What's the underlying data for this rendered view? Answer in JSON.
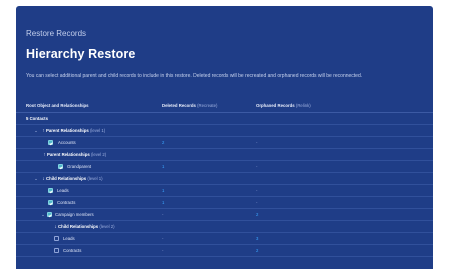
{
  "header": {
    "supertitle": "Restore Records",
    "title": "Hierarchy Restore",
    "description": "You can select additional parent and child records to include in this restore. Deleted records will be recreated and orphaned records will be reconnected."
  },
  "table": {
    "columns": {
      "object_label": "Root Object and Relationships",
      "deleted_label": "Deleted Records",
      "deleted_action": "(Recreate)",
      "orphaned_label": "Orphaned Records",
      "orphaned_action": "(Relink)"
    },
    "rows": [
      {
        "label": "5 Contacts",
        "level": "",
        "deleted": "",
        "orphaned": ""
      },
      {
        "label": "Parent Relationships",
        "level": "(level 1)",
        "deleted": "",
        "orphaned": "",
        "arrow": "↑",
        "chevron": "⌄"
      },
      {
        "label": "Accounts",
        "level": "",
        "deleted": "2",
        "orphaned": "-",
        "checked": true
      },
      {
        "label": "Parent Relationships",
        "level": "(level 2)",
        "deleted": "",
        "orphaned": "",
        "arrow": "↑"
      },
      {
        "label": "Grandparent",
        "level": "",
        "deleted": "1",
        "orphaned": "-",
        "checked": true
      },
      {
        "label": "Child Relationships",
        "level": "(level 1)",
        "deleted": "",
        "orphaned": "",
        "arrow": "↓",
        "chevron": "⌄"
      },
      {
        "label": "Leads",
        "level": "",
        "deleted": "1",
        "orphaned": "-",
        "checked": true
      },
      {
        "label": "Contracts",
        "level": "",
        "deleted": "1",
        "orphaned": "-",
        "checked": true
      },
      {
        "label": "Campaign members",
        "level": "",
        "deleted": "-",
        "orphaned": "2",
        "checked": true,
        "chevron": "⌄"
      },
      {
        "label": "Child Relationships",
        "level": "(level 2)",
        "deleted": "",
        "orphaned": "",
        "arrow": "↓"
      },
      {
        "label": "Leads",
        "level": "",
        "deleted": "-",
        "orphaned": "3",
        "checked": false
      },
      {
        "label": "Contracts",
        "level": "",
        "deleted": "-",
        "orphaned": "2",
        "checked": false
      }
    ]
  },
  "colors": {
    "panel_bg": "#1f3d87",
    "accent_count": "#3aa6ff",
    "checkbox_checked": "#4fb6c9"
  },
  "icons": {
    "expand": "chevron-down-icon",
    "parent": "arrow-up-icon",
    "child": "arrow-down-icon",
    "checkbox": "checkbox-icon"
  }
}
